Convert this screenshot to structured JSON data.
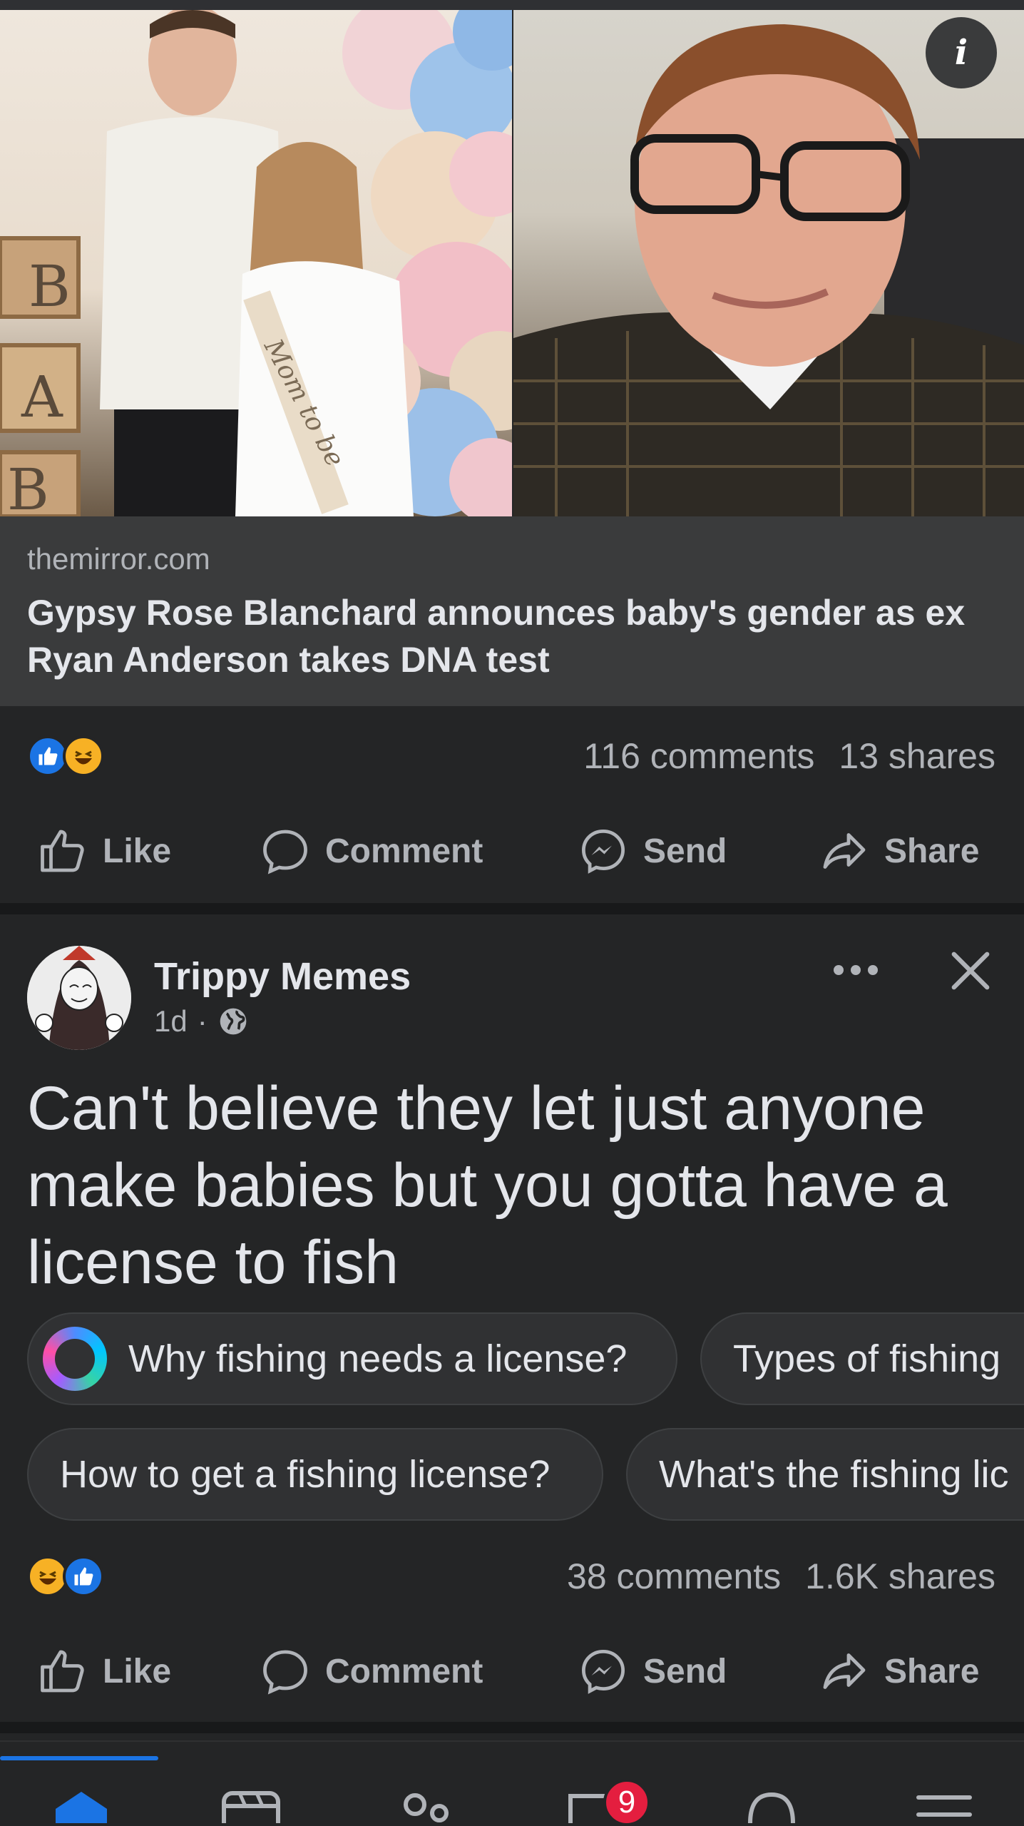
{
  "post1": {
    "link_domain": "themirror.com",
    "link_title": "Gypsy Rose Blanchard announces baby's gender as ex Ryan Anderson takes DNA test",
    "photo_sash_text": "Mom to be",
    "photo_blocks": [
      "B",
      "A",
      "B"
    ],
    "info_label": "i",
    "comments": "116 comments",
    "shares": "13 shares"
  },
  "actions": {
    "like": "Like",
    "comment": "Comment",
    "send": "Send",
    "share": "Share"
  },
  "post2": {
    "page_name": "Trippy Memes",
    "time": "1d",
    "separator": "·",
    "text": "Can't believe they let just anyone make babies but you gotta have a license to fish",
    "chips": [
      "Why fishing needs a license?",
      "Types of fishing",
      "How to get a fishing license?",
      "What's the fishing lic"
    ],
    "comments": "38 comments",
    "shares": "1.6K shares"
  },
  "bottom_nav": {
    "items": [
      "home-icon",
      "video-icon",
      "friends-icon",
      "marketplace-icon",
      "notifications-icon",
      "menu-icon"
    ],
    "badge": "9"
  },
  "colors": {
    "background": "#242526",
    "card": "#3a3b3c",
    "accent": "#1b74e4",
    "badge": "#e41e3f",
    "muted_text": "#b0b3b8"
  }
}
